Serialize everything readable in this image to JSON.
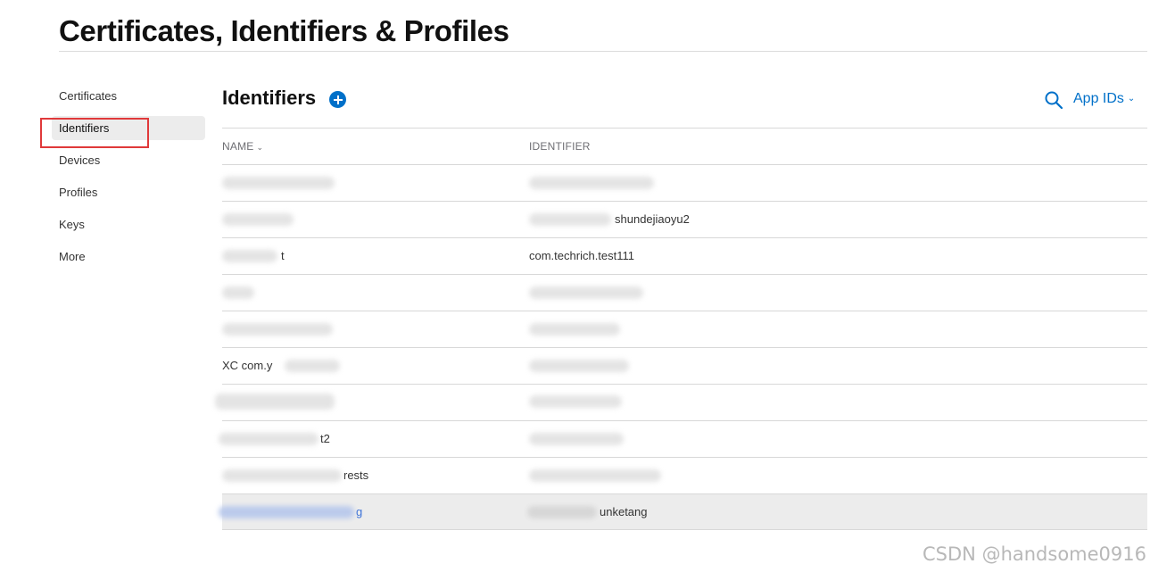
{
  "header": {
    "title": "Certificates, Identifiers & Profiles"
  },
  "sidebar": {
    "items": [
      {
        "label": "Certificates",
        "active": false
      },
      {
        "label": "Identifiers",
        "active": true
      },
      {
        "label": "Devices",
        "active": false
      },
      {
        "label": "Profiles",
        "active": false
      },
      {
        "label": "Keys",
        "active": false
      },
      {
        "label": "More",
        "active": false
      }
    ]
  },
  "main": {
    "section_title": "Identifiers",
    "filter_label": "App IDs",
    "columns": {
      "name": "NAME",
      "identifier": "IDENTIFIER"
    },
    "rows": [
      {
        "name": "",
        "identifier": ""
      },
      {
        "name": "",
        "identifier": "shundejiaoyu2"
      },
      {
        "name": "t",
        "identifier": "com.techrich.test111"
      },
      {
        "name": "",
        "identifier": ""
      },
      {
        "name": "",
        "identifier": ""
      },
      {
        "name": "XC com.y",
        "identifier": ""
      },
      {
        "name": "",
        "identifier": ""
      },
      {
        "name": "t2",
        "identifier": ""
      },
      {
        "name": "rests",
        "identifier": ""
      },
      {
        "name": "g",
        "identifier": "unketang"
      }
    ],
    "selected_row": 9
  },
  "watermark": "CSDN @handsome0916",
  "colors": {
    "accent": "#0070c9",
    "highlight_box": "#e0393a",
    "selected_bg": "#ececec"
  },
  "icons": [
    "add-circle-icon",
    "search-icon",
    "chevron-down-icon"
  ]
}
